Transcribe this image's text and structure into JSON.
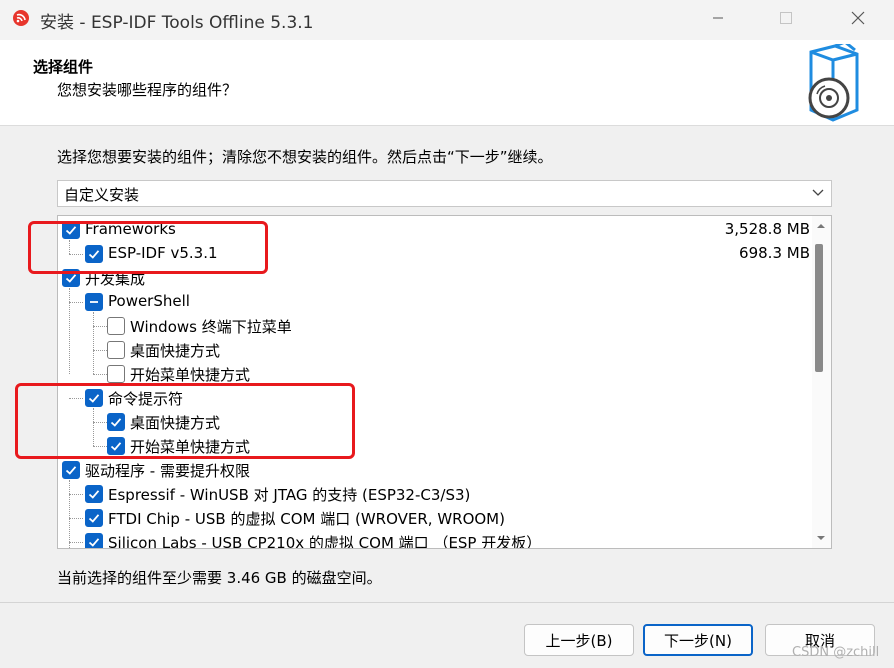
{
  "window": {
    "title": "安装 - ESP-IDF Tools Offline 5.3.1",
    "controls": {
      "minimize": "—",
      "maximize": "☐",
      "close": "✕"
    }
  },
  "header": {
    "title": "选择组件",
    "subtitle": "您想安装哪些程序的组件？",
    "logo_icon": "box-disc-icon"
  },
  "instruction": "选择您想要安装的组件；清除您不想安装的组件。然后点击“下一步”继续。",
  "install_type": {
    "selected": "自定义安装"
  },
  "components": [
    {
      "label": "Frameworks",
      "size": "3,528.8 MB",
      "state": "checked",
      "level": 0
    },
    {
      "label": "ESP-IDF v5.3.1",
      "size": "698.3 MB",
      "state": "checked",
      "level": 1
    },
    {
      "label": "开发集成",
      "size": "",
      "state": "checked",
      "level": 0
    },
    {
      "label": "PowerShell",
      "size": "",
      "state": "partial",
      "level": 1
    },
    {
      "label": "Windows 终端下拉菜单",
      "size": "",
      "state": "unchecked",
      "level": 2
    },
    {
      "label": "桌面快捷方式",
      "size": "",
      "state": "unchecked",
      "level": 2
    },
    {
      "label": "开始菜单快捷方式",
      "size": "",
      "state": "unchecked",
      "level": 2
    },
    {
      "label": "命令提示符",
      "size": "",
      "state": "checked",
      "level": 1
    },
    {
      "label": "桌面快捷方式",
      "size": "",
      "state": "checked",
      "level": 2
    },
    {
      "label": "开始菜单快捷方式",
      "size": "",
      "state": "checked",
      "level": 2
    },
    {
      "label": "驱动程序 - 需要提升权限",
      "size": "",
      "state": "checked",
      "level": 0
    },
    {
      "label": "Espressif - WinUSB 对 JTAG 的支持 (ESP32-C3/S3)",
      "size": "",
      "state": "checked",
      "level": 1
    },
    {
      "label": "FTDI Chip - USB 的虚拟 COM 端口 (WROVER, WROOM)",
      "size": "",
      "state": "checked",
      "level": 1
    },
    {
      "label": "Silicon Labs - USB CP210x 的虚拟 COM 端口 （ESP 开发板）",
      "size": "",
      "state": "checked",
      "level": 1
    }
  ],
  "disk_space": "当前选择的组件至少需要 3.46 GB 的磁盘空间。",
  "buttons": {
    "back": "上一步(B)",
    "next": "下一步(N)",
    "cancel": "取消"
  },
  "watermark": "CSDN @zchill",
  "colors": {
    "accent": "#0a64c8",
    "highlight_box": "#e8191d"
  }
}
